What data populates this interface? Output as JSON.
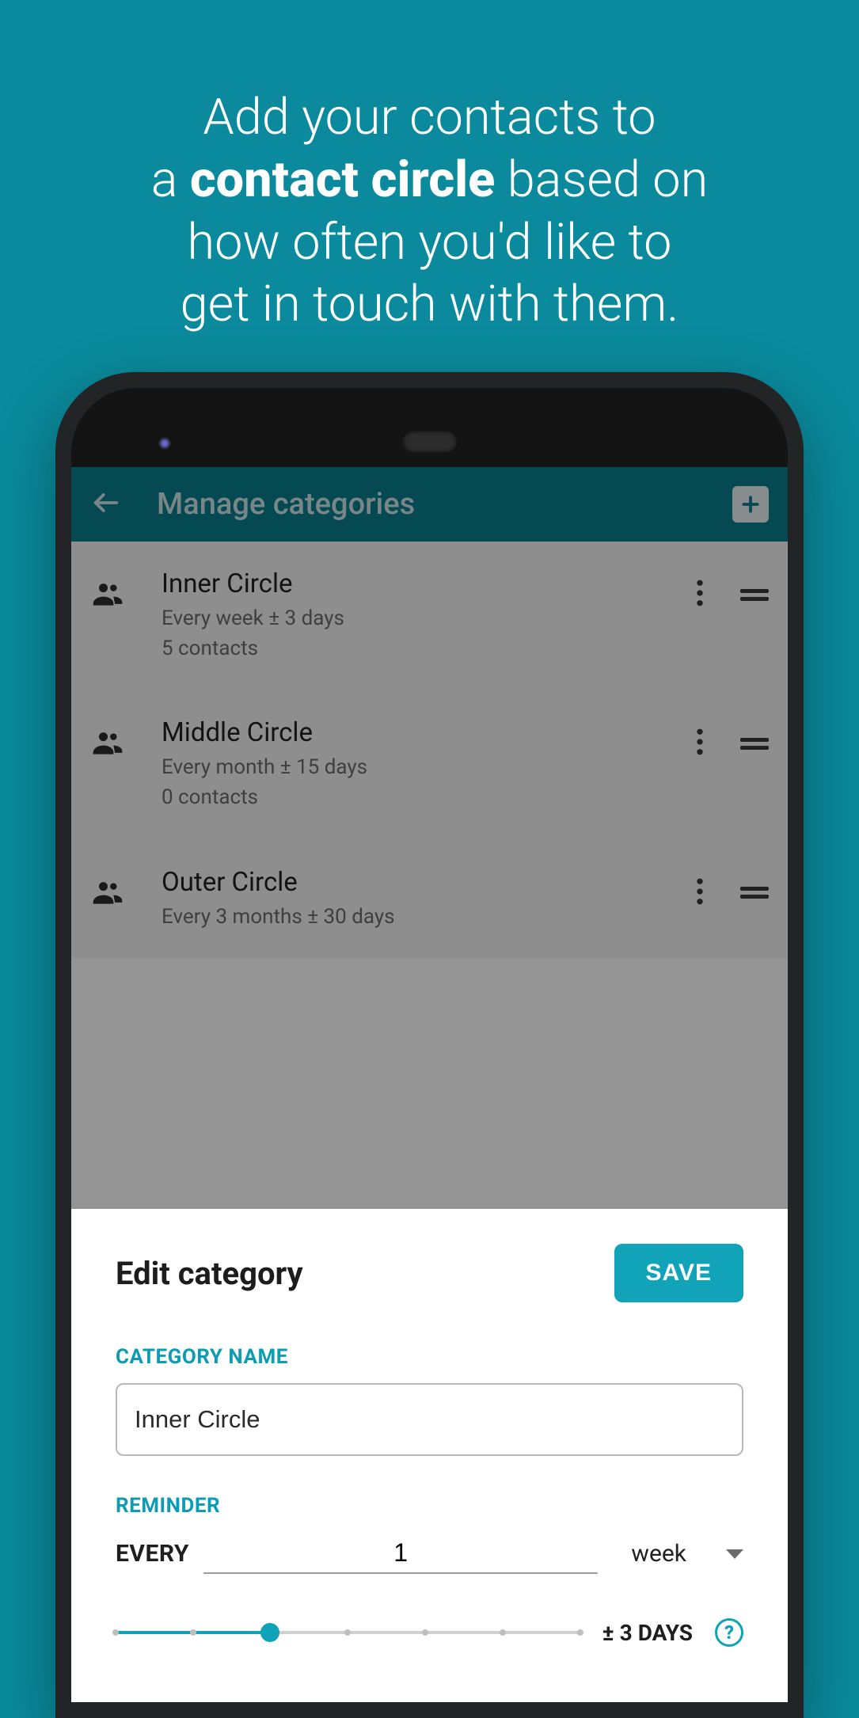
{
  "promo": {
    "line1": "Add your contacts to",
    "line2_pre": "a ",
    "line2_bold": "contact circle",
    "line2_post": " based on",
    "line3": "how often you'd like to",
    "line4": "get in touch with them."
  },
  "appbar": {
    "title": "Manage categories"
  },
  "categories": [
    {
      "name": "Inner Circle",
      "frequency": "Every week ± 3 days",
      "contacts": "5 contacts"
    },
    {
      "name": "Middle Circle",
      "frequency": "Every month ± 15 days",
      "contacts": "0 contacts"
    },
    {
      "name": "Outer Circle",
      "frequency": "Every 3 months ± 30 days",
      "contacts": ""
    }
  ],
  "sheet": {
    "title": "Edit category",
    "save_label": "SAVE",
    "category_name_label": "CATEGORY NAME",
    "category_name_value": "Inner Circle",
    "reminder_label": "REMINDER",
    "every_label": "EVERY",
    "every_value": "1",
    "unit_value": "week",
    "tolerance_label": "± 3 DAYS",
    "slider": {
      "ticks": 7,
      "value_index": 2
    }
  },
  "colors": {
    "brand": "#0a8a9c",
    "accent": "#0fa2b8"
  }
}
